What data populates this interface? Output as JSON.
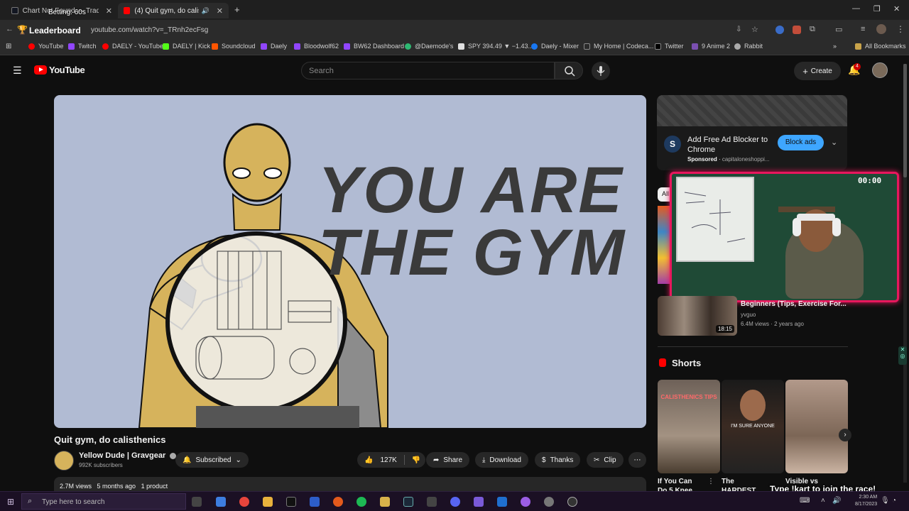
{
  "overlay": {
    "betting": "Betting: 60s",
    "leaderboard": "Leaderboard",
    "kart_prompt": "Type !kart to join the race!",
    "timer": "00:00"
  },
  "browser": {
    "tabs": [
      {
        "label": "Chart Not Found — TradingVie",
        "active": false
      },
      {
        "label": "(4) Quit gym, do calisthenic",
        "active": true
      }
    ],
    "url": "youtube.com/watch?v=_TRnh2ecFsg",
    "bookmarks": [
      "YouTube",
      "Twitch",
      "DAELY - YouTube",
      "DAELY | Kick",
      "Soundcloud",
      "Daely",
      "Bloodwolf62",
      "BW62 Dashboard",
      "@Daemode's",
      "SPY 394.49 ▼ −1.43...",
      "Daely - Mixer",
      "My Home | Codeca...",
      "Twitter",
      "9 Anime 2",
      "Rabbit"
    ],
    "all_bookmarks": "All Bookmarks"
  },
  "youtube": {
    "logo": "YouTube",
    "search_placeholder": "Search",
    "create": "Create",
    "notif_count": "4"
  },
  "video": {
    "headline_line1": "YOU ARE",
    "headline_line2": "THE GYM",
    "title": "Quit gym, do calisthenics",
    "channel": "Yellow Dude | Gravgear",
    "subscribers": "992K subscribers",
    "subscribed": "Subscribed",
    "likes": "127K",
    "share": "Share",
    "download": "Download",
    "thanks": "Thanks",
    "clip": "Clip",
    "views": "2.7M views",
    "age": "5 months ago",
    "product": "1 product"
  },
  "ad": {
    "title": "Add Free Ad Blocker to Chrome",
    "sponsored": "Sponsored",
    "domain": "capitaloneshoppi...",
    "cta": "Block ads",
    "logo_letter": "S"
  },
  "sidebar": {
    "chip_all": "All",
    "rec_title": "Beginners (Tips, Exercise For...",
    "rec_channel": "yvguo",
    "rec_meta": "6.4M views · 2 years ago",
    "rec_duration": "18:15",
    "shorts_label": "Shorts",
    "shorts": [
      {
        "overlay": "CALISTHENICS TIPS",
        "title": "If You Can Do 5 Knee..."
      },
      {
        "overlay": "I'M SURE ANYONE",
        "title": "The HARDEST..."
      },
      {
        "overlay": "",
        "title": "Visible vs"
      }
    ]
  },
  "taskbar": {
    "search_placeholder": "Type here to search",
    "time": "2:30 AM",
    "date": "8/17/2023"
  },
  "colors": {
    "accent_red": "#ff0000",
    "cam_border": "#e8175d",
    "video_bg": "#b1bbd3",
    "figure_yellow": "#d6b35c",
    "ad_button": "#3ea6ff"
  }
}
